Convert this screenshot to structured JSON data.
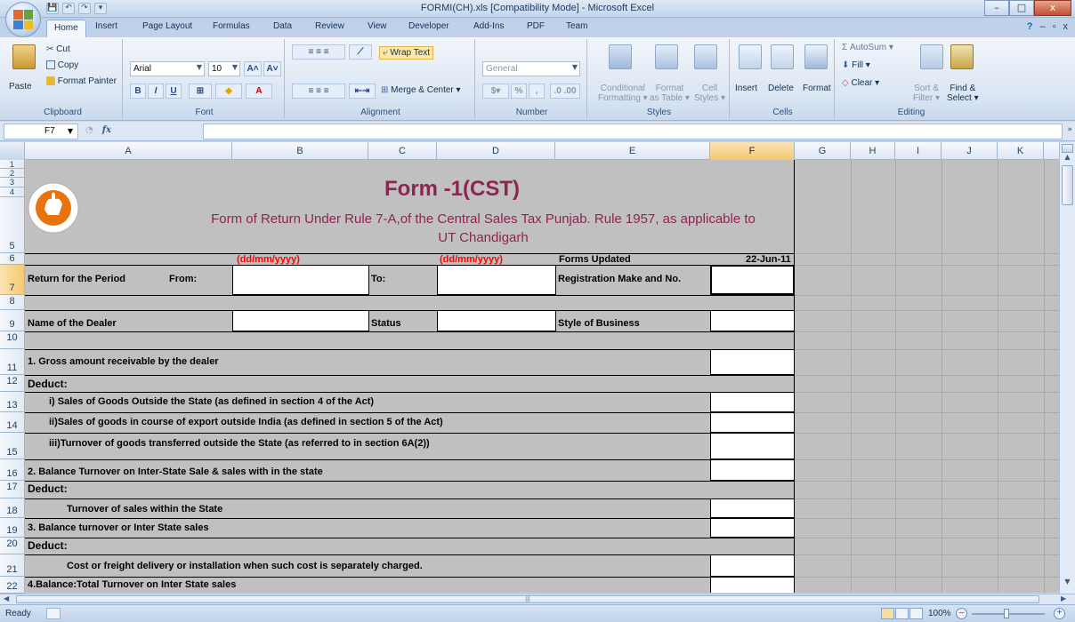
{
  "window": {
    "title": "FORMI(CH).xls  [Compatibility Mode] - Microsoft Excel",
    "minimize": "–",
    "maximize": "□",
    "close": "x"
  },
  "qat": [
    "💾",
    "↶",
    "↷",
    "▾"
  ],
  "tabs": [
    "Home",
    "Insert",
    "Page Layout",
    "Formulas",
    "Data",
    "Review",
    "View",
    "Developer",
    "Add-Ins",
    "PDF",
    "Team"
  ],
  "help": {
    "help": "?",
    "min": "–",
    "restore": "▫",
    "close": "x"
  },
  "ribbon": {
    "clipboard": {
      "label": "Clipboard",
      "paste": "Paste",
      "cut": "Cut",
      "copy": "Copy",
      "format_painter": "Format Painter"
    },
    "font": {
      "label": "Font",
      "family": "Arial",
      "size": "10",
      "grow": "A˄",
      "shrink": "A˅",
      "bold": "B",
      "italic": "I",
      "underline": "U"
    },
    "alignment": {
      "label": "Alignment",
      "wrap_text": "Wrap Text",
      "merge_center": "Merge & Center"
    },
    "number": {
      "label": "Number",
      "format": "General",
      "percent": "%",
      "comma": ","
    },
    "styles": {
      "label": "Styles",
      "conditional": "Conditional",
      "conditional2": "Formatting",
      "format_table": "Format",
      "format_table2": "as Table",
      "cell_styles": "Cell",
      "cell_styles2": "Styles"
    },
    "cells": {
      "label": "Cells",
      "insert": "Insert",
      "delete": "Delete",
      "format": "Format"
    },
    "editing": {
      "label": "Editing",
      "autosum": "AutoSum",
      "fill": "Fill",
      "clear": "Clear",
      "sort": "Sort &",
      "sort2": "Filter",
      "find": "Find &",
      "find2": "Select"
    }
  },
  "formula_bar": {
    "name_box": "F7",
    "fx": "fx",
    "content": ""
  },
  "columns": [
    "A",
    "B",
    "C",
    "D",
    "E",
    "F",
    "G",
    "H",
    "I",
    "J",
    "K"
  ],
  "selected_column": "F",
  "rows": [
    "1",
    "2",
    "3",
    "4",
    "5",
    "6",
    "7",
    "8",
    "9",
    "10",
    "11",
    "12",
    "13",
    "14",
    "15",
    "16",
    "17",
    "18",
    "19",
    "20",
    "21",
    "22"
  ],
  "selected_row": "7",
  "sheet": {
    "title": "Form -1(CST)",
    "subtitle_line1": "Form of Return Under Rule 7-A,of the Central Sales Tax Punjab. Rule 1957, as applicable to",
    "subtitle_line2": "UT Chandigarh",
    "date_hint_from": "(dd/mm/yyyy)",
    "date_hint_to": "(dd/mm/yyyy)",
    "forms_updated_label": "Forms Updated",
    "forms_updated_value": "22-Jun-11",
    "return_period": "Return for the Period",
    "from": "From:",
    "to": "To:",
    "registration": "Registration Make and No.",
    "dealer_name": "Name of the Dealer",
    "status": "Status",
    "style_business": "Style of Business",
    "line11": "1. Gross amount receivable by the dealer",
    "deduct": "Deduct:",
    "line13": "i) Sales of Goods Outside the State (as defined in section 4 of the Act)",
    "line14": "ii)Sales of goods in course of export outside India (as defined in section 5 of the Act)",
    "line15": "iii)Turnover of goods transferred outside the State (as referred to in section 6A(2))",
    "line16": "2. Balance Turnover on Inter-State  Sale & sales with in the state",
    "line18": "Turnover of sales within the State",
    "line19": "3. Balance turnover or Inter State sales",
    "line21": "Cost or freight delivery or installation when such cost is  separately charged.",
    "line22": "4.Balance:Total Turnover on Inter State sales"
  },
  "status_bar": {
    "ready": "Ready",
    "zoom": "100%",
    "zoom_minus": "–",
    "zoom_plus": "+"
  },
  "colors": {
    "title": "#8e2452",
    "hint": "#ff0000",
    "logo": "#e8720c"
  }
}
